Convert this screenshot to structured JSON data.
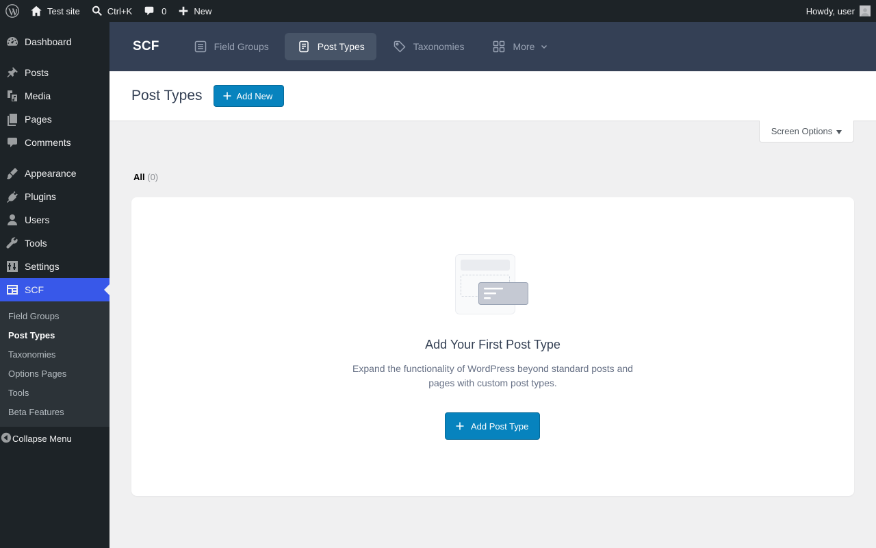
{
  "adminbar": {
    "site_name": "Test site",
    "search_shortcut": "Ctrl+K",
    "comments_count": "0",
    "new_label": "New",
    "howdy": "Howdy, user"
  },
  "sidebar": {
    "items": [
      {
        "label": "Dashboard",
        "icon": "dashboard-icon"
      },
      {
        "label": "Posts",
        "icon": "pin-icon"
      },
      {
        "label": "Media",
        "icon": "media-icon"
      },
      {
        "label": "Pages",
        "icon": "pages-icon"
      },
      {
        "label": "Comments",
        "icon": "comment-icon"
      },
      {
        "label": "Appearance",
        "icon": "brush-icon"
      },
      {
        "label": "Plugins",
        "icon": "plugin-icon"
      },
      {
        "label": "Users",
        "icon": "user-icon"
      },
      {
        "label": "Tools",
        "icon": "wrench-icon"
      },
      {
        "label": "Settings",
        "icon": "settings-icon"
      },
      {
        "label": "SCF",
        "icon": "grid-icon"
      }
    ],
    "submenu": [
      "Field Groups",
      "Post Types",
      "Taxonomies",
      "Options Pages",
      "Tools",
      "Beta Features"
    ],
    "collapse_label": "Collapse Menu"
  },
  "scf_header": {
    "logo": "SCF",
    "tabs": [
      "Field Groups",
      "Post Types",
      "Taxonomies",
      "More"
    ]
  },
  "page": {
    "title": "Post Types",
    "add_new_label": "Add New",
    "screen_options": "Screen Options",
    "filter_all": "All",
    "filter_count": "(0)"
  },
  "empty": {
    "title": "Add Your First Post Type",
    "description": "Expand the functionality of WordPress beyond standard posts and pages with custom post types.",
    "button_label": "Add Post Type"
  },
  "colors": {
    "accent": "#3858e9",
    "primary_button": "#0783be",
    "scf_header": "#344055"
  }
}
